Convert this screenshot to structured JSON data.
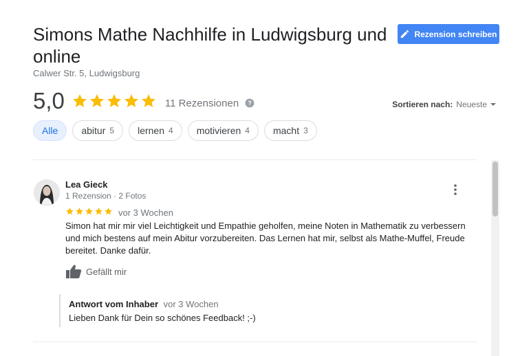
{
  "business": {
    "title": "Simons Mathe Nachhilfe in Ludwigsburg und online",
    "address": "Calwer Str. 5, Ludwigsburg"
  },
  "header": {
    "write_review_label": "Rezension schreiben",
    "accent_color": "#4285f4"
  },
  "summary": {
    "rating": "5,0",
    "stars": 5,
    "review_count": "11 Rezensionen",
    "star_color": "#fbbc04"
  },
  "sort": {
    "label": "Sortieren nach:",
    "value": "Neueste"
  },
  "chips": [
    {
      "label": "Alle",
      "count": "",
      "active": true
    },
    {
      "label": "abitur",
      "count": "5"
    },
    {
      "label": "lernen",
      "count": "4"
    },
    {
      "label": "motivieren",
      "count": "4"
    },
    {
      "label": "macht",
      "count": "3"
    }
  ],
  "review": {
    "name": "Lea Gieck",
    "meta": "1 Rezension · 2 Fotos",
    "stars": 5,
    "time": "vor 3 Wochen",
    "text": "Simon hat mir mir viel Leichtigkeit und Empathie geholfen, meine Noten in Mathematik zu verbessern und mich bestens auf mein Abitur vorzubereiten. Das Lernen hat mir, selbst als Mathe-Muffel, Freude bereitet. Danke dafür.",
    "like_label": "Gefällt mir",
    "reply": {
      "owner": "Antwort vom Inhaber",
      "time": "vor 3 Wochen",
      "text": "Lieben Dank für Dein so schönes Feedback! ;-)"
    }
  }
}
